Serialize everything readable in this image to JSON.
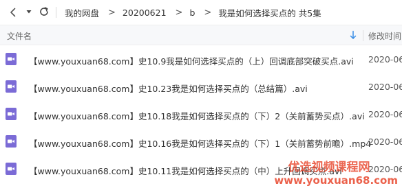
{
  "toolbar": {
    "back_icon": "chevron-left-icon",
    "dropdown_icon": "caret-down-icon",
    "refresh_icon": "refresh-icon",
    "breadcrumbs": [
      "我的网盘",
      "20200621",
      "b",
      "我是如何选择买点的 共5集"
    ],
    "separator": ">"
  },
  "header": {
    "name_column": "文件名",
    "date_column": "修改时间",
    "sort_icon": "arrow-down-icon",
    "accent_color": "#3a8ee6"
  },
  "files": [
    {
      "name": "【www.youxuan68.com】史10.9我是如何选择买点的（上）回调底部突破买点.avi",
      "date": "2020-06-",
      "icon": "video-file-icon"
    },
    {
      "name": "【www.youxuan68.com】史10.23我是如何选择买点的（总结篇）.avi",
      "date": "2020-06-",
      "icon": "video-file-icon"
    },
    {
      "name": "【www.youxuan68.com】史10.18我是如何选择买点的（下）2（关前蓄势买点）.avi",
      "date": "2020-06-",
      "icon": "video-file-icon"
    },
    {
      "name": "【www.youxuan68.com】史10.16我是如何选择买点的（下）1（关前蓄势前瞻）.mp4",
      "date": "2020-06-",
      "icon": "video-file-icon"
    },
    {
      "name": "【www.youxuan68.com】史10.11我是如何选择买点的（中）上升回调买点.avi",
      "date": "2020-06-",
      "icon": "video-file-icon"
    }
  ],
  "icon_color": "#7b6bd6",
  "watermark": {
    "line1": "优选视频课程网",
    "line2": "www.youxuan68.com",
    "color": "#e8452c"
  }
}
